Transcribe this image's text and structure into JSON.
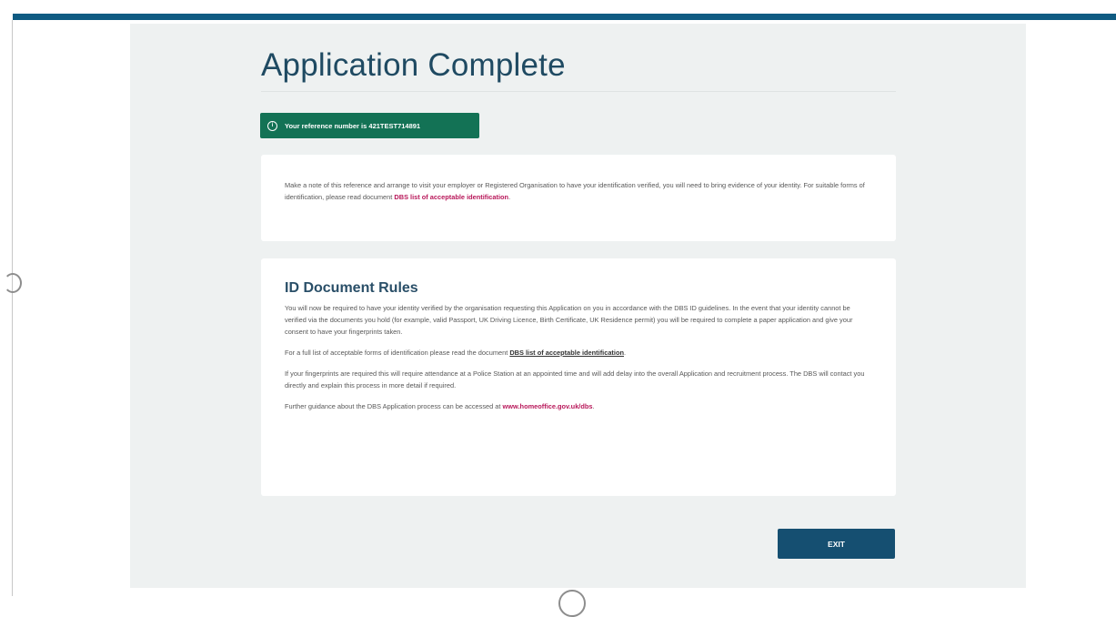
{
  "page": {
    "title": "Application Complete",
    "accent_color": "#0f5b82",
    "banner_color": "#137255"
  },
  "reference_banner": {
    "icon": "info-icon",
    "text": "Your reference number is 421TEST714891"
  },
  "note_card": {
    "text_before_link": "Make a note of this reference and arrange to visit your employer or Registered Organisation to have your identification verified, you will need to bring evidence of your identity. For suitable forms of identification, please read document ",
    "link_text": "DBS list of acceptable identification",
    "text_after_link": "."
  },
  "rules_card": {
    "heading": "ID Document Rules",
    "paragraph_1": "You will now be required to have your identity verified by the organisation requesting this Application on you in accordance with the DBS ID guidelines. In the event that your identity cannot be verified via the documents you hold (for example, valid Passport, UK Driving Licence, Birth Certificate, UK Residence permit) you will be required to complete a paper application and give your consent to have your fingerprints taken.",
    "paragraph_2_before_link": "For a full list of acceptable forms of identification please read the document ",
    "paragraph_2_link": "DBS list of acceptable identification",
    "paragraph_2_after_link": ".",
    "paragraph_3": "If your fingerprints are required this will require attendance at a Police Station at an appointed time and will add delay into the overall Application and recruitment process. The DBS will contact you directly and explain this process in more detail if required.",
    "paragraph_4_before_link": "Further guidance about the DBS Application process can be accessed at ",
    "paragraph_4_link": "www.homeoffice.gov.uk/dbs",
    "paragraph_4_after_link": "."
  },
  "actions": {
    "exit_label": "EXIT"
  }
}
